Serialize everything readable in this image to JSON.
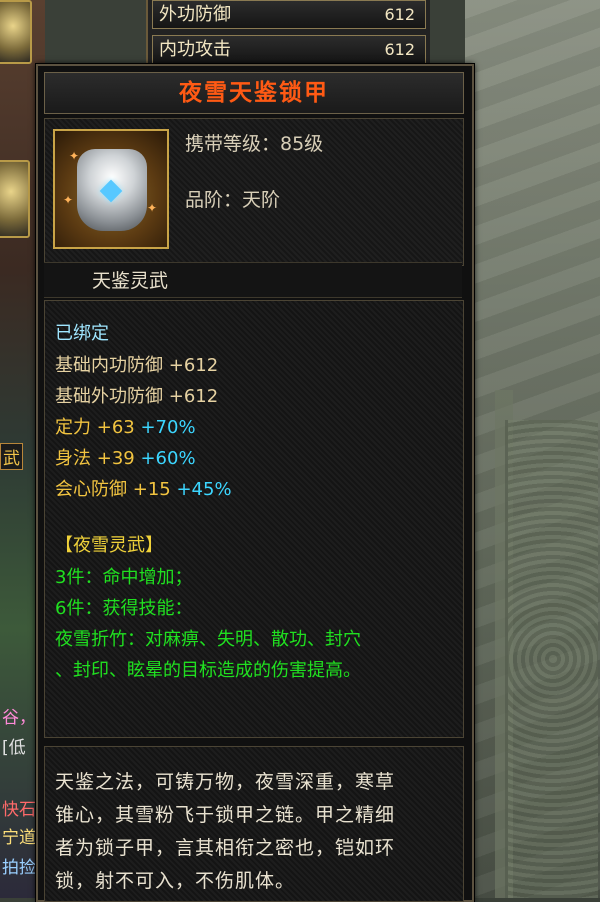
{
  "background": {
    "fragments": [
      "武",
      "谷，",
      "[低",
      "快石",
      "宁道",
      "拍捡"
    ]
  },
  "stats": [
    {
      "name": "外功防御",
      "value": "612"
    },
    {
      "name": "内功攻击",
      "value": "612"
    }
  ],
  "tooltip": {
    "title": "夜雪天鉴锁甲",
    "icon": "armor-icon",
    "level": "携带等级：85级",
    "grade": "品阶：天阶",
    "skin": "天鉴灵武",
    "bound": "已绑定",
    "base_stats": [
      {
        "name": "基础内功防御",
        "value": "+612"
      },
      {
        "name": "基础外功防御",
        "value": "+612"
      }
    ],
    "attributes": [
      {
        "name": "定力",
        "value": "+63",
        "bonus": "+70%"
      },
      {
        "name": "身法",
        "value": "+39",
        "bonus": "+60%"
      },
      {
        "name": "会心防御",
        "value": "+15",
        "bonus": "+45%"
      }
    ],
    "set": {
      "name": "【夜雪灵武】",
      "lines": [
        "3件：命中增加；",
        "6件：获得技能：",
        "夜雪折竹：对麻痹、失明、散功、封穴",
        "、封印、眩晕的目标造成的伤害提高。"
      ]
    },
    "description": [
      "天鉴之法，可铸万物，夜雪深重，寒草",
      "锥心，其雪粉飞于锁甲之链。甲之精细",
      "者为锁子甲，言其相衔之密也，铠如环",
      "锁，射不可入，不伤肌体。"
    ]
  },
  "colors": {
    "title": "#ff5a14",
    "bound": "#9fe6ff",
    "gold": "#f2c440",
    "bonus": "#3cd6ff",
    "set_name": "#f0d23a",
    "set_text": "#20e020"
  }
}
